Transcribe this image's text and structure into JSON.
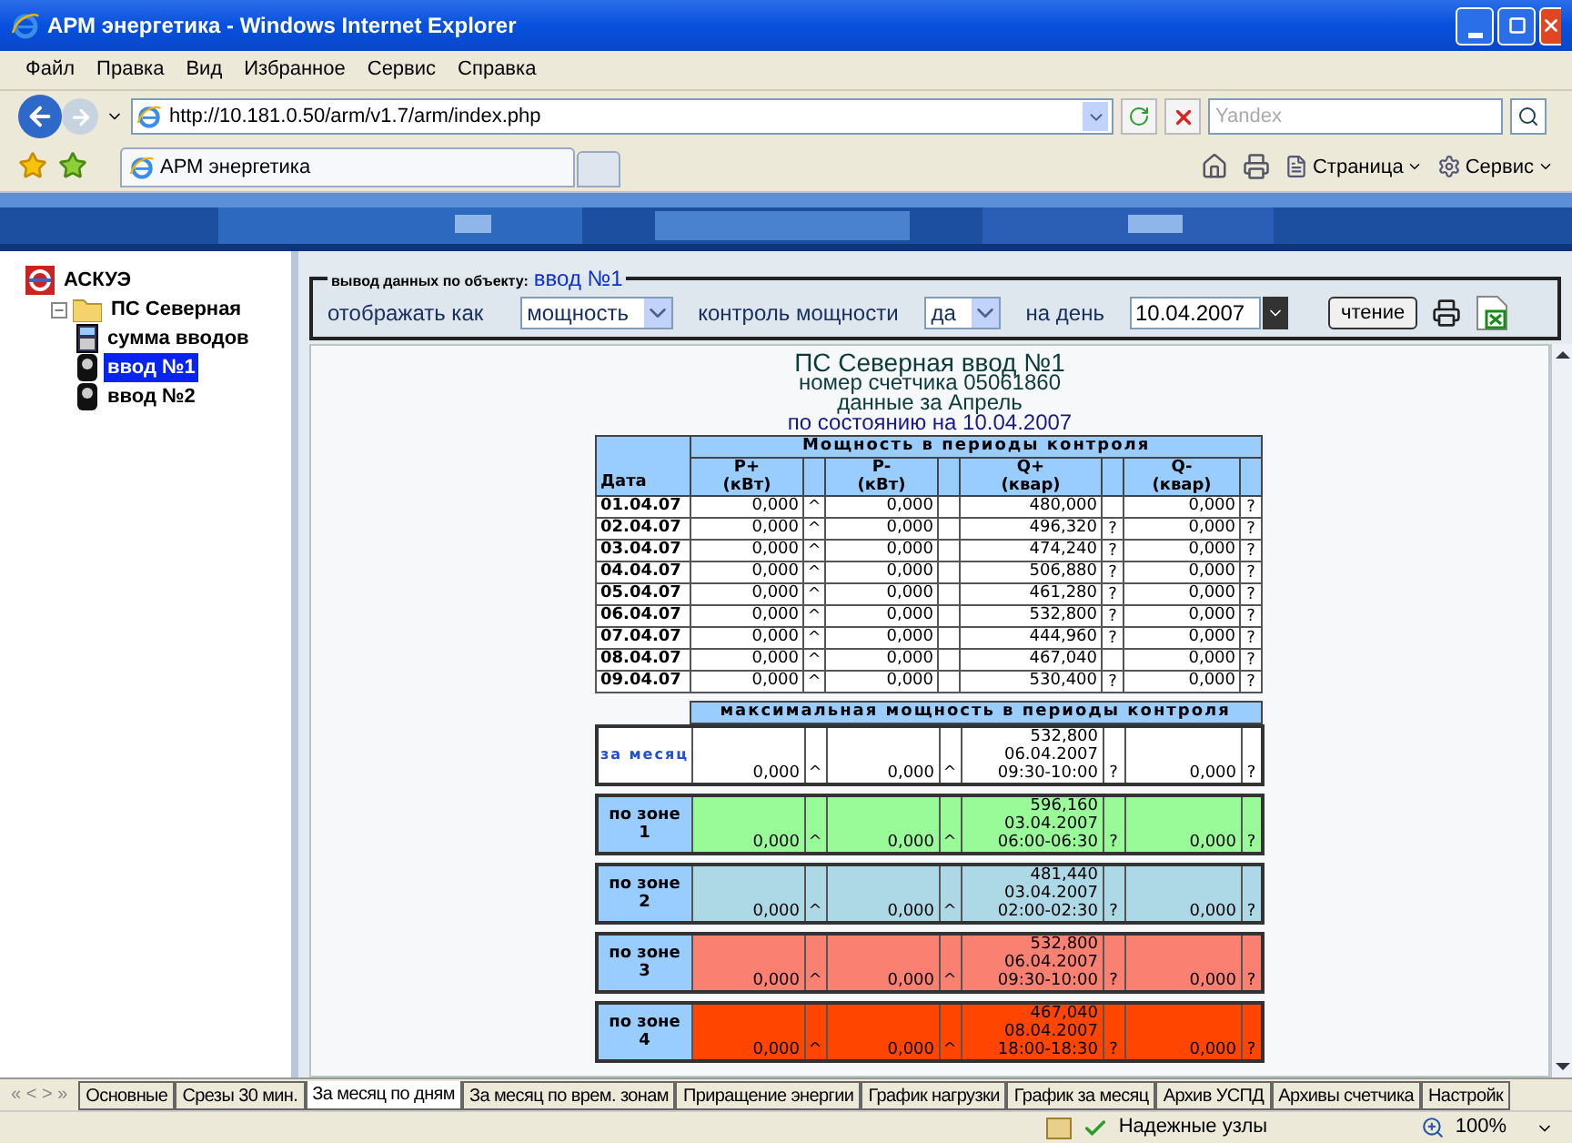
{
  "window": {
    "title": "АРМ энергетика - Windows Internet Explorer"
  },
  "menu": [
    "Файл",
    "Правка",
    "Вид",
    "Избранное",
    "Сервис",
    "Справка"
  ],
  "address": {
    "value": "http://10.181.0.50/arm/v1.7/arm/index.php"
  },
  "search": {
    "placeholder": "Yandex"
  },
  "browser_tabs": [
    {
      "label": "АРМ энергетика",
      "selected": true
    }
  ],
  "command_bar": [
    "Страница",
    "Сервис"
  ],
  "tree": {
    "label": "АСКУЭ",
    "children": [
      {
        "label": "ПС Северная",
        "expanded": true,
        "children": [
          {
            "label": "сумма вводов",
            "kind": "sum",
            "selected": false
          },
          {
            "label": "ввод №1",
            "kind": "meter",
            "selected": true
          },
          {
            "label": "ввод №2",
            "kind": "meter",
            "selected": false
          }
        ]
      }
    ]
  },
  "controls": {
    "legend": "вывод данных по объекту:",
    "object": "ввод №1",
    "display_label": "отображать как",
    "display_value": "мощность",
    "control_label": "контроль мощности",
    "control_value": "да",
    "day_label": "на день",
    "day_value": "10.04.2007",
    "read_button": "чтение"
  },
  "report": {
    "title_lines": [
      "ПС Северная ввод №1",
      "номер счетчика 05061860",
      "данные за Апрель",
      "по состоянию на 10.04.2007"
    ],
    "date_header": "Дата",
    "group_header": "Мощность в периоды контроля",
    "columns": [
      {
        "label": "P+",
        "unit": "(кВт)"
      },
      {
        "label": "P-",
        "unit": "(кВт)"
      },
      {
        "label": "Q+",
        "unit": "(квар)"
      },
      {
        "label": "Q-",
        "unit": "(квар)"
      }
    ],
    "rows": [
      {
        "date": "01.04.07",
        "values": [
          {
            "v": "0,000",
            "flag": "^"
          },
          {
            "v": "0,000"
          },
          {
            "v": "480,000"
          },
          {
            "v": "0,000",
            "flag": "?"
          }
        ]
      },
      {
        "date": "02.04.07",
        "values": [
          {
            "v": "0,000",
            "flag": "^"
          },
          {
            "v": "0,000"
          },
          {
            "v": "496,320",
            "flag": "?"
          },
          {
            "v": "0,000",
            "flag": "?"
          }
        ]
      },
      {
        "date": "03.04.07",
        "values": [
          {
            "v": "0,000",
            "flag": "^"
          },
          {
            "v": "0,000"
          },
          {
            "v": "474,240",
            "flag": "?"
          },
          {
            "v": "0,000",
            "flag": "?"
          }
        ]
      },
      {
        "date": "04.04.07",
        "values": [
          {
            "v": "0,000",
            "flag": "^"
          },
          {
            "v": "0,000"
          },
          {
            "v": "506,880",
            "flag": "?"
          },
          {
            "v": "0,000",
            "flag": "?"
          }
        ]
      },
      {
        "date": "05.04.07",
        "values": [
          {
            "v": "0,000",
            "flag": "^"
          },
          {
            "v": "0,000"
          },
          {
            "v": "461,280",
            "flag": "?"
          },
          {
            "v": "0,000",
            "flag": "?"
          }
        ]
      },
      {
        "date": "06.04.07",
        "values": [
          {
            "v": "0,000",
            "flag": "^"
          },
          {
            "v": "0,000"
          },
          {
            "v": "532,800",
            "flag": "?"
          },
          {
            "v": "0,000",
            "flag": "?"
          }
        ]
      },
      {
        "date": "07.04.07",
        "values": [
          {
            "v": "0,000",
            "flag": "^"
          },
          {
            "v": "0,000"
          },
          {
            "v": "444,960",
            "flag": "?"
          },
          {
            "v": "0,000",
            "flag": "?"
          }
        ]
      },
      {
        "date": "08.04.07",
        "values": [
          {
            "v": "0,000",
            "flag": "^"
          },
          {
            "v": "0,000"
          },
          {
            "v": "467,040"
          },
          {
            "v": "0,000",
            "flag": "?"
          }
        ]
      },
      {
        "date": "09.04.07",
        "values": [
          {
            "v": "0,000",
            "flag": "^"
          },
          {
            "v": "0,000"
          },
          {
            "v": "530,400",
            "flag": "?"
          },
          {
            "v": "0,000",
            "flag": "?"
          }
        ]
      }
    ],
    "max_header": "максимальная мощность в периоды контроля",
    "max_rows": [
      {
        "kind": "month",
        "label": "за месяц",
        "color": "#ffffff",
        "values": [
          {
            "lines": [
              "0,000"
            ],
            "flag": "^"
          },
          {
            "lines": [
              "0,000"
            ],
            "flag": "^"
          },
          {
            "lines": [
              "532,800",
              "06.04.2007",
              "09:30-10:00"
            ],
            "flag": "?"
          },
          {
            "lines": [
              "0,000"
            ],
            "flag": "?"
          }
        ]
      },
      {
        "kind": "zone",
        "label": "по зоне",
        "zone": "1",
        "color": "#98fb98",
        "values": [
          {
            "lines": [
              "0,000"
            ],
            "flag": "^"
          },
          {
            "lines": [
              "0,000"
            ],
            "flag": "^"
          },
          {
            "lines": [
              "596,160",
              "03.04.2007",
              "06:00-06:30"
            ],
            "flag": "?"
          },
          {
            "lines": [
              "0,000"
            ],
            "flag": "?"
          }
        ]
      },
      {
        "kind": "zone",
        "label": "по зоне",
        "zone": "2",
        "color": "#add8e6",
        "values": [
          {
            "lines": [
              "0,000"
            ],
            "flag": "^"
          },
          {
            "lines": [
              "0,000"
            ],
            "flag": "^"
          },
          {
            "lines": [
              "481,440",
              "03.04.2007",
              "02:00-02:30"
            ],
            "flag": "?"
          },
          {
            "lines": [
              "0,000"
            ],
            "flag": "?"
          }
        ]
      },
      {
        "kind": "zone",
        "label": "по зоне",
        "zone": "3",
        "color": "#fa8072",
        "values": [
          {
            "lines": [
              "0,000"
            ],
            "flag": "^"
          },
          {
            "lines": [
              "0,000"
            ],
            "flag": "^"
          },
          {
            "lines": [
              "532,800",
              "06.04.2007",
              "09:30-10:00"
            ],
            "flag": "?"
          },
          {
            "lines": [
              "0,000"
            ],
            "flag": "?"
          }
        ]
      },
      {
        "kind": "zone",
        "label": "по зоне",
        "zone": "4",
        "color": "#ff4500",
        "values": [
          {
            "lines": [
              "0,000"
            ],
            "flag": "^"
          },
          {
            "lines": [
              "0,000"
            ],
            "flag": "^"
          },
          {
            "lines": [
              "467,040",
              "08.04.2007",
              "18:00-18:30"
            ],
            "flag": "?"
          },
          {
            "lines": [
              "0,000"
            ],
            "flag": "?"
          }
        ]
      }
    ]
  },
  "sheet_nav": "« < > »",
  "sheet_tabs": [
    {
      "label": "Основные",
      "selected": false
    },
    {
      "label": "Срезы 30 мин.",
      "selected": false
    },
    {
      "label": "За месяц по дням",
      "selected": true
    },
    {
      "label": "За месяц по врем. зонам",
      "selected": false
    },
    {
      "label": "Приращение энергии",
      "selected": false
    },
    {
      "label": "График нагрузки",
      "selected": false
    },
    {
      "label": "График за месяц",
      "selected": false
    },
    {
      "label": "Архив  УСПД",
      "selected": false
    },
    {
      "label": "Архивы счетчика",
      "selected": false
    },
    {
      "label": "Настройк",
      "selected": false
    }
  ],
  "status_bar": {
    "zone": "Надежные узлы",
    "zoom": "100%"
  }
}
